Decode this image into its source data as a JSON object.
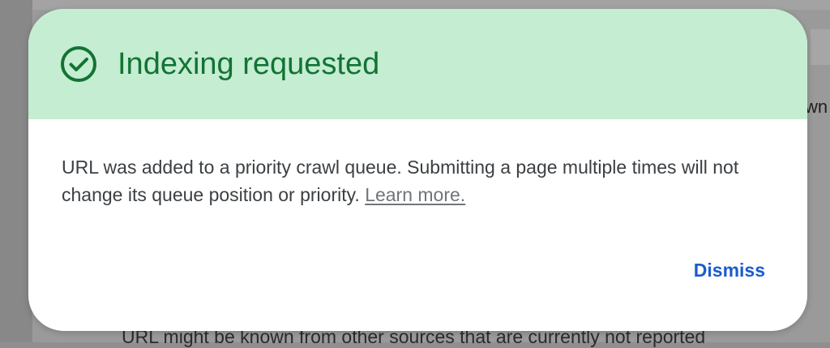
{
  "background": {
    "right_text": "wn",
    "bottom_text": "URL might be known from other sources that are currently not reported"
  },
  "dialog": {
    "title": "Indexing requested",
    "icon": "check-circle-icon",
    "body_text": "URL was added to a priority crawl queue. Submitting a page multiple times will not change its queue position or priority.",
    "learn_more_label": "Learn more.",
    "dismiss_label": "Dismiss"
  },
  "colors": {
    "header_background": "#c4edd2",
    "title_green": "#137333",
    "dismiss_blue": "#1a5ccf",
    "link_gray": "#70757a"
  }
}
